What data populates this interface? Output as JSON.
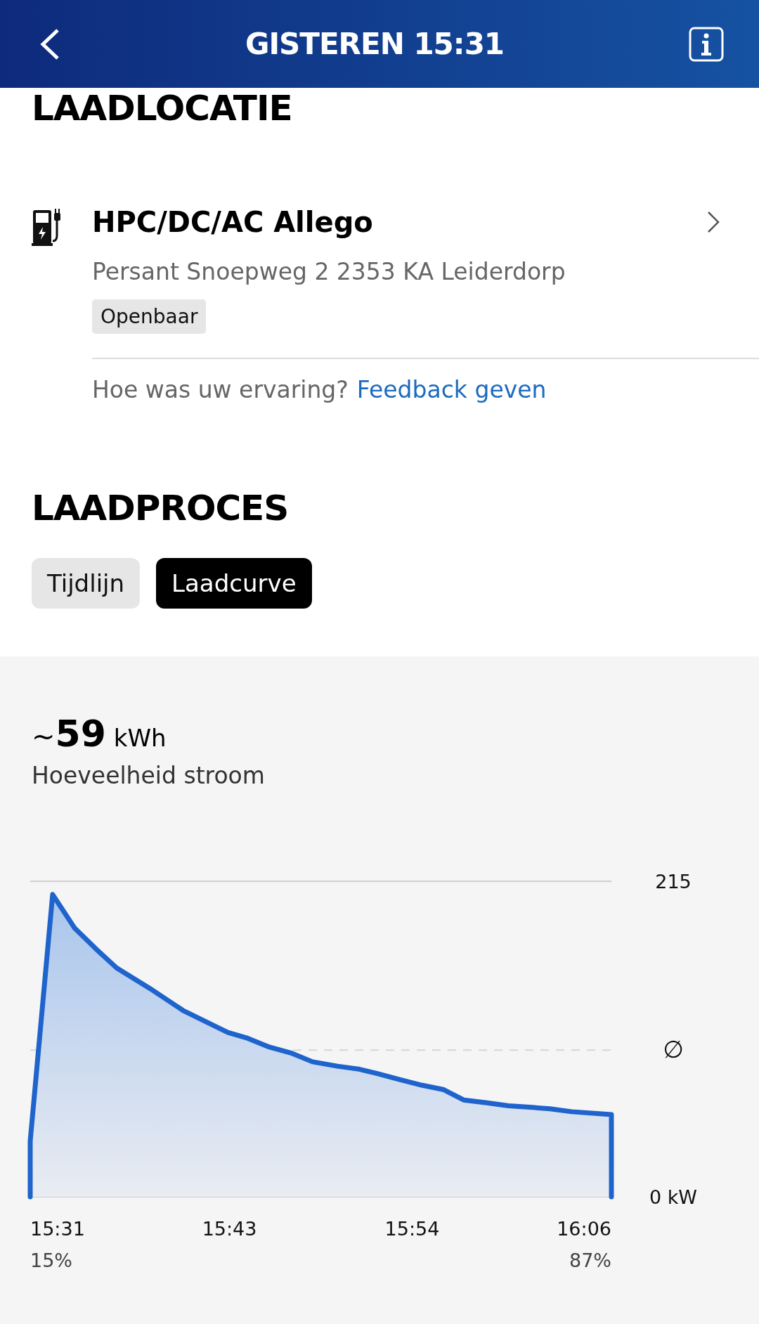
{
  "header": {
    "title": "GISTEREN 15:31"
  },
  "location": {
    "heading": "LAADLOCATIE",
    "station": "HPC/DC/AC Allego",
    "address": "Persant Snoepweg 2 2353 KA Leiderdorp",
    "tag": "Openbaar",
    "feedback_question": "Hoe was uw ervaring?",
    "feedback_link": "Feedback geven"
  },
  "process": {
    "heading": "LAADPROCES",
    "tabs": [
      {
        "label": "Tijdlijn",
        "selected": false
      },
      {
        "label": "Laadcurve",
        "selected": true
      }
    ]
  },
  "energy": {
    "prefix": "~",
    "value": "59",
    "unit": "kWh",
    "label": "Hoeveelheid stroom",
    "start_soc": "15%",
    "end_soc": "87%",
    "chart_data": {
      "type": "area",
      "x": [
        931,
        931,
        932.35,
        933.68,
        934.95,
        936.2,
        938.2,
        940.2,
        942.9,
        944.1,
        945.4,
        946.7,
        948.0,
        949.5,
        950.8,
        951.9,
        953.2,
        954.6,
        955.9,
        957.1,
        958.5,
        959.8,
        961.1,
        962.3,
        963.6,
        966,
        966
      ],
      "series": [
        {
          "color": "#1f63cc",
          "values": [
            0,
            38,
            206,
            183,
            169,
            156,
            142,
            127,
            112,
            108,
            102,
            98,
            92,
            89,
            87,
            84,
            80,
            76,
            73,
            66,
            64,
            62,
            61,
            60,
            58,
            56,
            0
          ]
        }
      ],
      "xlim": [
        931,
        966
      ],
      "ylim": [
        0,
        215
      ],
      "xticks": [
        {
          "value": 931,
          "label": "15:31"
        },
        {
          "value": 943,
          "label": "15:43"
        },
        {
          "value": 954,
          "label": "15:54"
        },
        {
          "value": 966,
          "label": "16:06"
        }
      ],
      "yticks": [
        {
          "value": 0,
          "label": "0 kW"
        },
        {
          "value": 215,
          "label": "215"
        }
      ],
      "ref_lines": [
        {
          "axis": "y",
          "value": 100,
          "label": "∅"
        }
      ]
    }
  }
}
